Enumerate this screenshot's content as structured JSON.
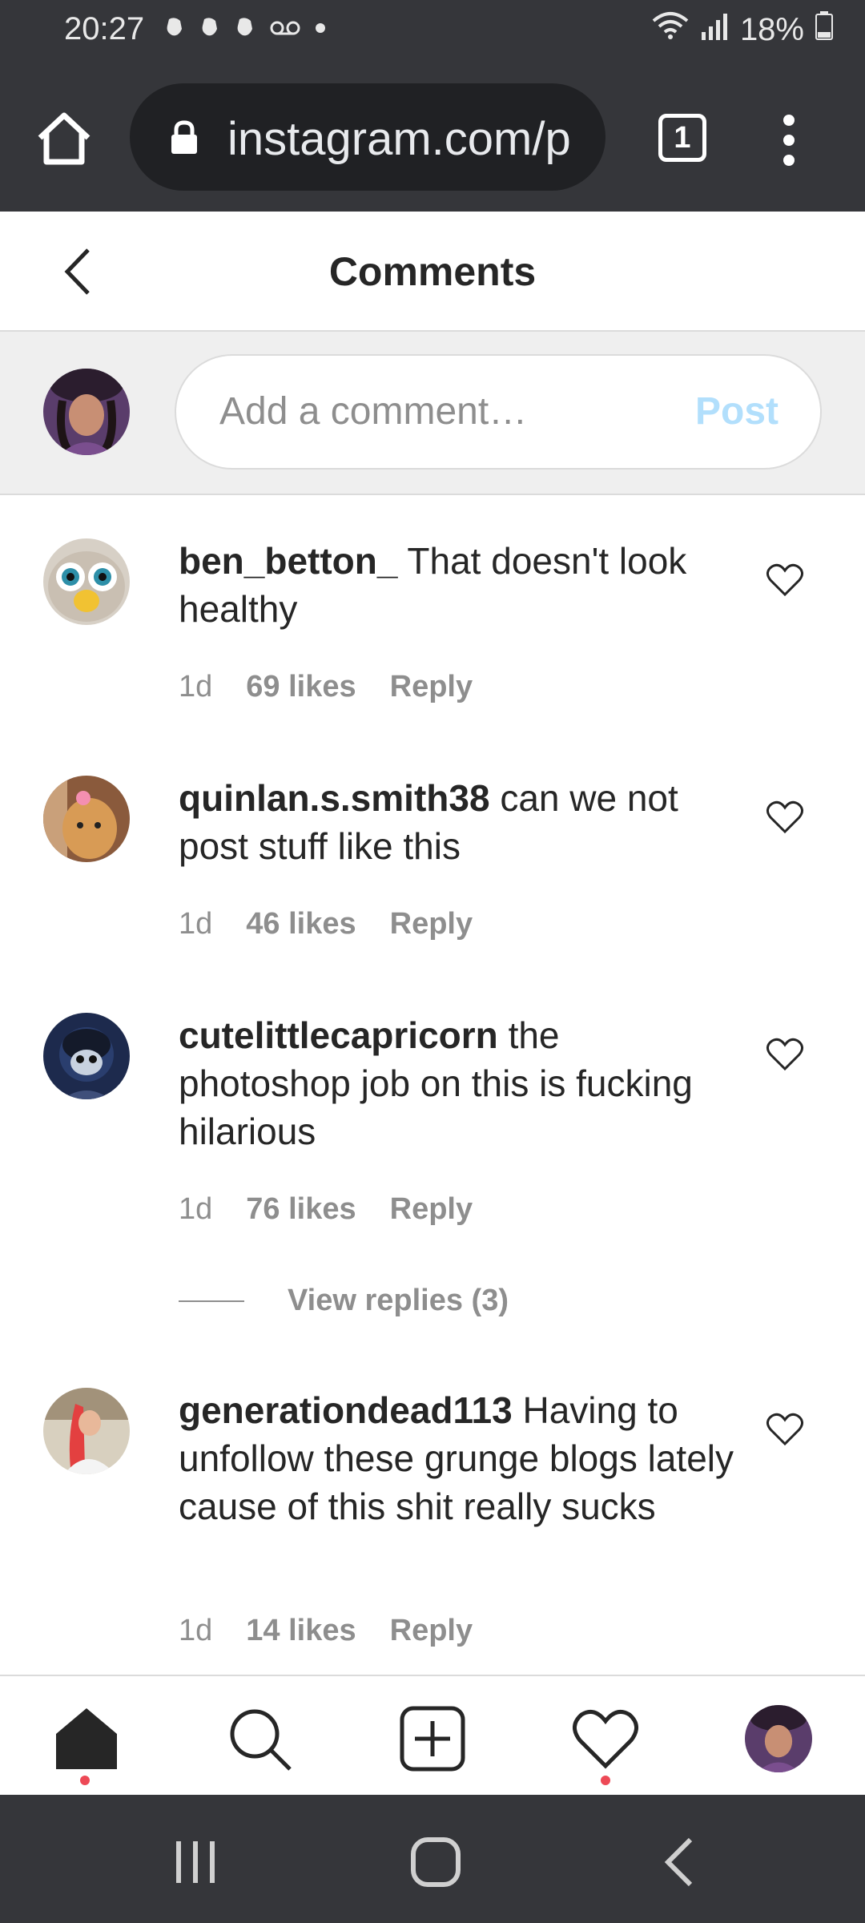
{
  "status_bar": {
    "time": "20:27",
    "battery": "18%"
  },
  "browser": {
    "url": "instagram.com/p",
    "tab_count": "1"
  },
  "header": {
    "title": "Comments"
  },
  "composer": {
    "placeholder": "Add a comment…",
    "post_label": "Post"
  },
  "comments": [
    {
      "username": "ben_betton_",
      "text": "That doesn't look healthy",
      "age": "1d",
      "likes": "69 likes",
      "reply": "Reply"
    },
    {
      "username": "quinlan.s.smith38",
      "text": "can we not post stuff like this",
      "age": "1d",
      "likes": "46 likes",
      "reply": "Reply"
    },
    {
      "username": "cutelittlecapricorn",
      "text": "the photoshop job on this is fucking hilarious",
      "age": "1d",
      "likes": "76 likes",
      "reply": "Reply",
      "view_replies": "View replies (3)"
    },
    {
      "username": "generationdead113",
      "text": "Having to unfollow these grunge blogs lately cause of this shit really sucks",
      "age": "1d",
      "likes": "14 likes",
      "reply": "Reply"
    }
  ],
  "colors": {
    "chrome_bg": "#35363a",
    "text_primary": "#262626",
    "text_secondary": "#8e8e8e",
    "post_disabled": "#b2dffc",
    "notification_dot": "#ed4956"
  }
}
